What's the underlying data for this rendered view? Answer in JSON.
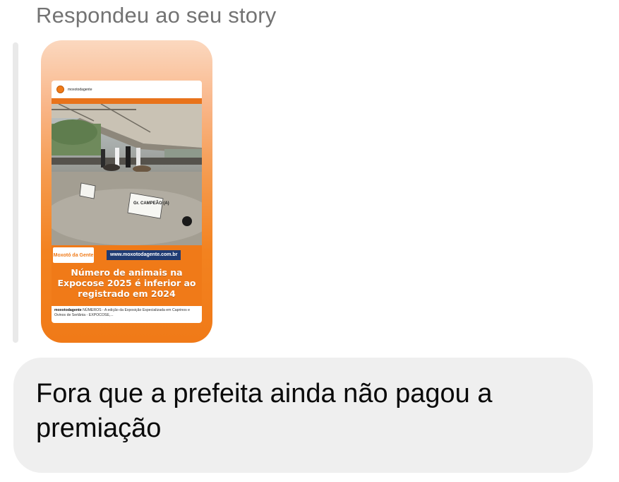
{
  "reply": {
    "header": "Respondeu ao seu story"
  },
  "story": {
    "account": "moxotodagente",
    "brand": "Moxotó da Gente",
    "url": "www.moxotodagente.com.br",
    "sign_text": "Gr. CAMPEÃO (A)",
    "headline": "Número de animais na Expocose 2025 é inferior ao registrado em 2024",
    "caption_account": "moxotodagente",
    "caption_text": "NÚMEROS - A edição da Exposição Especializada em Caprinos e Ovinos de Sertânia - EXPOCOSE,...",
    "colors": {
      "brand_orange": "#f07a18",
      "url_blue": "#1f3b73"
    }
  },
  "message": {
    "text": "Fora que a prefeita ainda não pagou a premiação",
    "bubble_color": "#efefef"
  }
}
